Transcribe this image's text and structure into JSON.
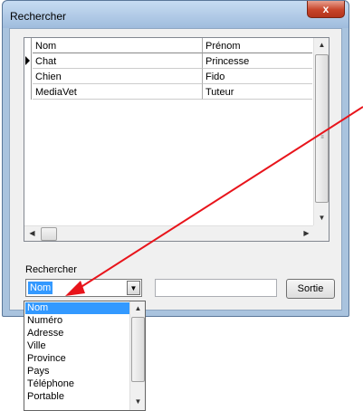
{
  "window": {
    "title": "Rechercher",
    "close_label": "x"
  },
  "grid": {
    "columns": [
      "Nom",
      "Prénom"
    ],
    "rows": [
      {
        "nom": "Chat",
        "prenom": "Princesse",
        "current": true
      },
      {
        "nom": "Chien",
        "prenom": "Fido",
        "current": false
      },
      {
        "nom": "MediaVet",
        "prenom": "Tuteur",
        "current": false
      }
    ]
  },
  "search": {
    "label": "Rechercher",
    "selected_field": "Nom",
    "text_value": "",
    "button_label": "Sortie"
  },
  "dropdown": {
    "options": [
      "Nom",
      "Numéro",
      "Adresse",
      "Ville",
      "Province",
      "Pays",
      "Téléphone",
      "Portable"
    ],
    "highlighted": "Nom"
  },
  "colors": {
    "selection": "#3399ff",
    "annotation_arrow": "#e8141b",
    "title_bar": "#a9c3de"
  },
  "icons": {
    "close": "close-icon",
    "row_pointer": "row-pointer-icon",
    "scroll_up": "arrow-up-icon",
    "scroll_down": "arrow-down-icon",
    "scroll_left": "arrow-left-icon",
    "scroll_right": "arrow-right-icon",
    "combo_toggle": "chevron-down-icon"
  }
}
